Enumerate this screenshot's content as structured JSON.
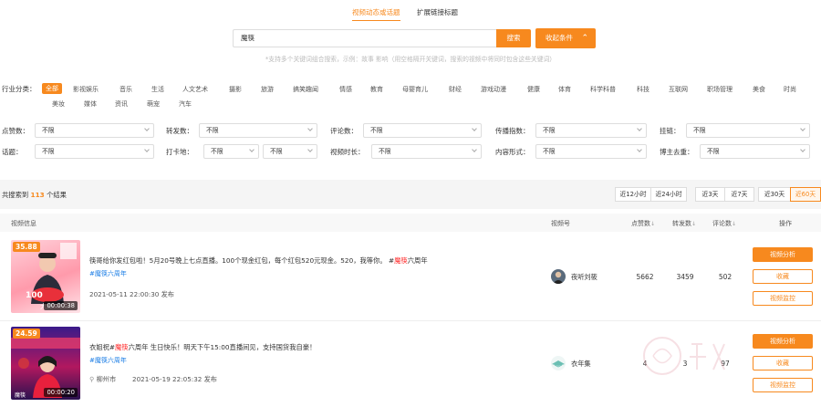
{
  "tabs": [
    {
      "label": "视频动态或话题",
      "active": true
    },
    {
      "label": "扩展链接标题",
      "active": false
    }
  ],
  "search": {
    "value": "魔筷",
    "button": "搜索",
    "collapse_button": "收起条件",
    "hint": "*支持多个关键词组合搜索，示例：故事 影响（用空格隔开关键词，搜索的视频中将同时包含这些关键词）"
  },
  "categories": {
    "label": "行业分类：",
    "items": [
      "全部",
      "影视娱乐",
      "音乐",
      "生活",
      "人文艺术",
      "摄影",
      "旅游",
      "搞笑趣闻",
      "情感",
      "教育",
      "母婴育儿",
      "财经",
      "游戏动漫",
      "健康",
      "体育",
      "科学科普",
      "科技",
      "互联网",
      "职场管理",
      "美食",
      "时尚",
      "美妆",
      "媒体",
      "资讯",
      "萌宠",
      "汽车"
    ]
  },
  "filters": {
    "row1": [
      {
        "label": "点赞数：",
        "value": "不限"
      },
      {
        "label": "转发数：",
        "value": "不限"
      },
      {
        "label": "评论数：",
        "value": "不限"
      },
      {
        "label": "传播指数：",
        "value": "不限"
      },
      {
        "label": "挂链：",
        "value": "不限"
      }
    ],
    "row2": [
      {
        "label": "话题：",
        "value": "不限"
      },
      {
        "label": "打卡地：",
        "value": "不限",
        "value2": "不限"
      },
      {
        "label": "视频时长：",
        "value": "不限"
      },
      {
        "label": "内容形式：",
        "value": "不限"
      },
      {
        "label": "博主去重：",
        "value": "不限"
      }
    ]
  },
  "results": {
    "prefix": "共搜索到",
    "count": "113",
    "suffix": "个结果",
    "time_ranges": [
      "近12小时",
      "近24小时",
      "近3天",
      "近7天",
      "近30天",
      "近60天"
    ],
    "active_range": "近60天"
  },
  "table": {
    "headers": {
      "info": "视频信息",
      "account": "视频号",
      "likes": "点赞数",
      "shares": "转发数",
      "comments": "评论数",
      "ops": "操作"
    },
    "rows": [
      {
        "score": "35.88",
        "duration": "00:00:38",
        "desc_pre": "筷哥给你发红包啦！5月20号晚上七点直播。100个现金红包，每个红包520元现金。520，我等你。 #",
        "desc_hl": "魔筷",
        "desc_post": "六周年",
        "tag": "#魔筷六周年",
        "location": "",
        "date": "2021-05-11 22:00:30 发布",
        "account": "夜听刘筱",
        "likes": "5662",
        "shares": "3459",
        "comments": "502",
        "thumb_text": "100",
        "thumb_text2": "大额"
      },
      {
        "score": "24.59",
        "duration": "00:00:20",
        "desc_pre": "衣姐祝#",
        "desc_hl": "魔筷",
        "desc_post": "六周年 生日快乐！明天下午15:00直播间见，支持国货我自豪！",
        "tag": "#魔筷六周年",
        "location": "柳州市",
        "date": "2021-05-19 22:05:32 发布",
        "account": "衣年集",
        "likes": "4",
        "shares": "3",
        "comments": "97",
        "thumb_text": "魔筷",
        "thumb_text2": "魔筷"
      }
    ],
    "actions": [
      "视频分析",
      "收藏",
      "视频监控"
    ]
  },
  "colors": {
    "accent": "#f7891e",
    "link": "#1e7fe6",
    "highlight": "#ff2b2b"
  }
}
